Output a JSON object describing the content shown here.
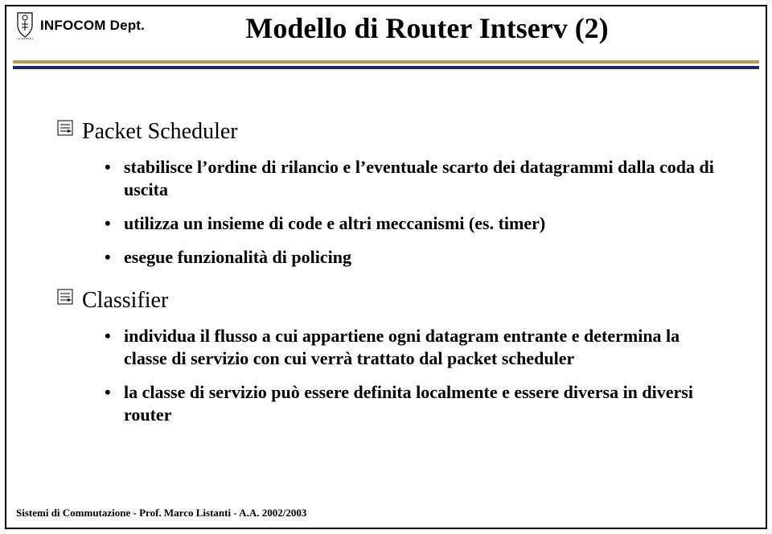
{
  "header": {
    "dept_label": "INFOCOM Dept.",
    "title": "Modello di Router Intserv (2)"
  },
  "content": {
    "section1": {
      "heading": "Packet Scheduler",
      "bullets": [
        "stabilisce l’ordine di rilancio e l’eventuale scarto dei datagrammi dalla coda di uscita",
        "utilizza un insieme di code e altri meccanismi (es. timer)",
        "esegue funzionalità di policing"
      ]
    },
    "section2": {
      "heading": "Classifier",
      "bullets": [
        "individua il flusso a cui appartiene ogni datagram entrante e determina la classe di servizio con cui verrà trattato dal packet scheduler",
        "la classe di servizio può essere definita localmente e essere diversa in diversi router"
      ]
    }
  },
  "footer": {
    "text": "Sistemi di Commutazione - Prof. Marco Listanti  - A.A.  2002/2003"
  }
}
